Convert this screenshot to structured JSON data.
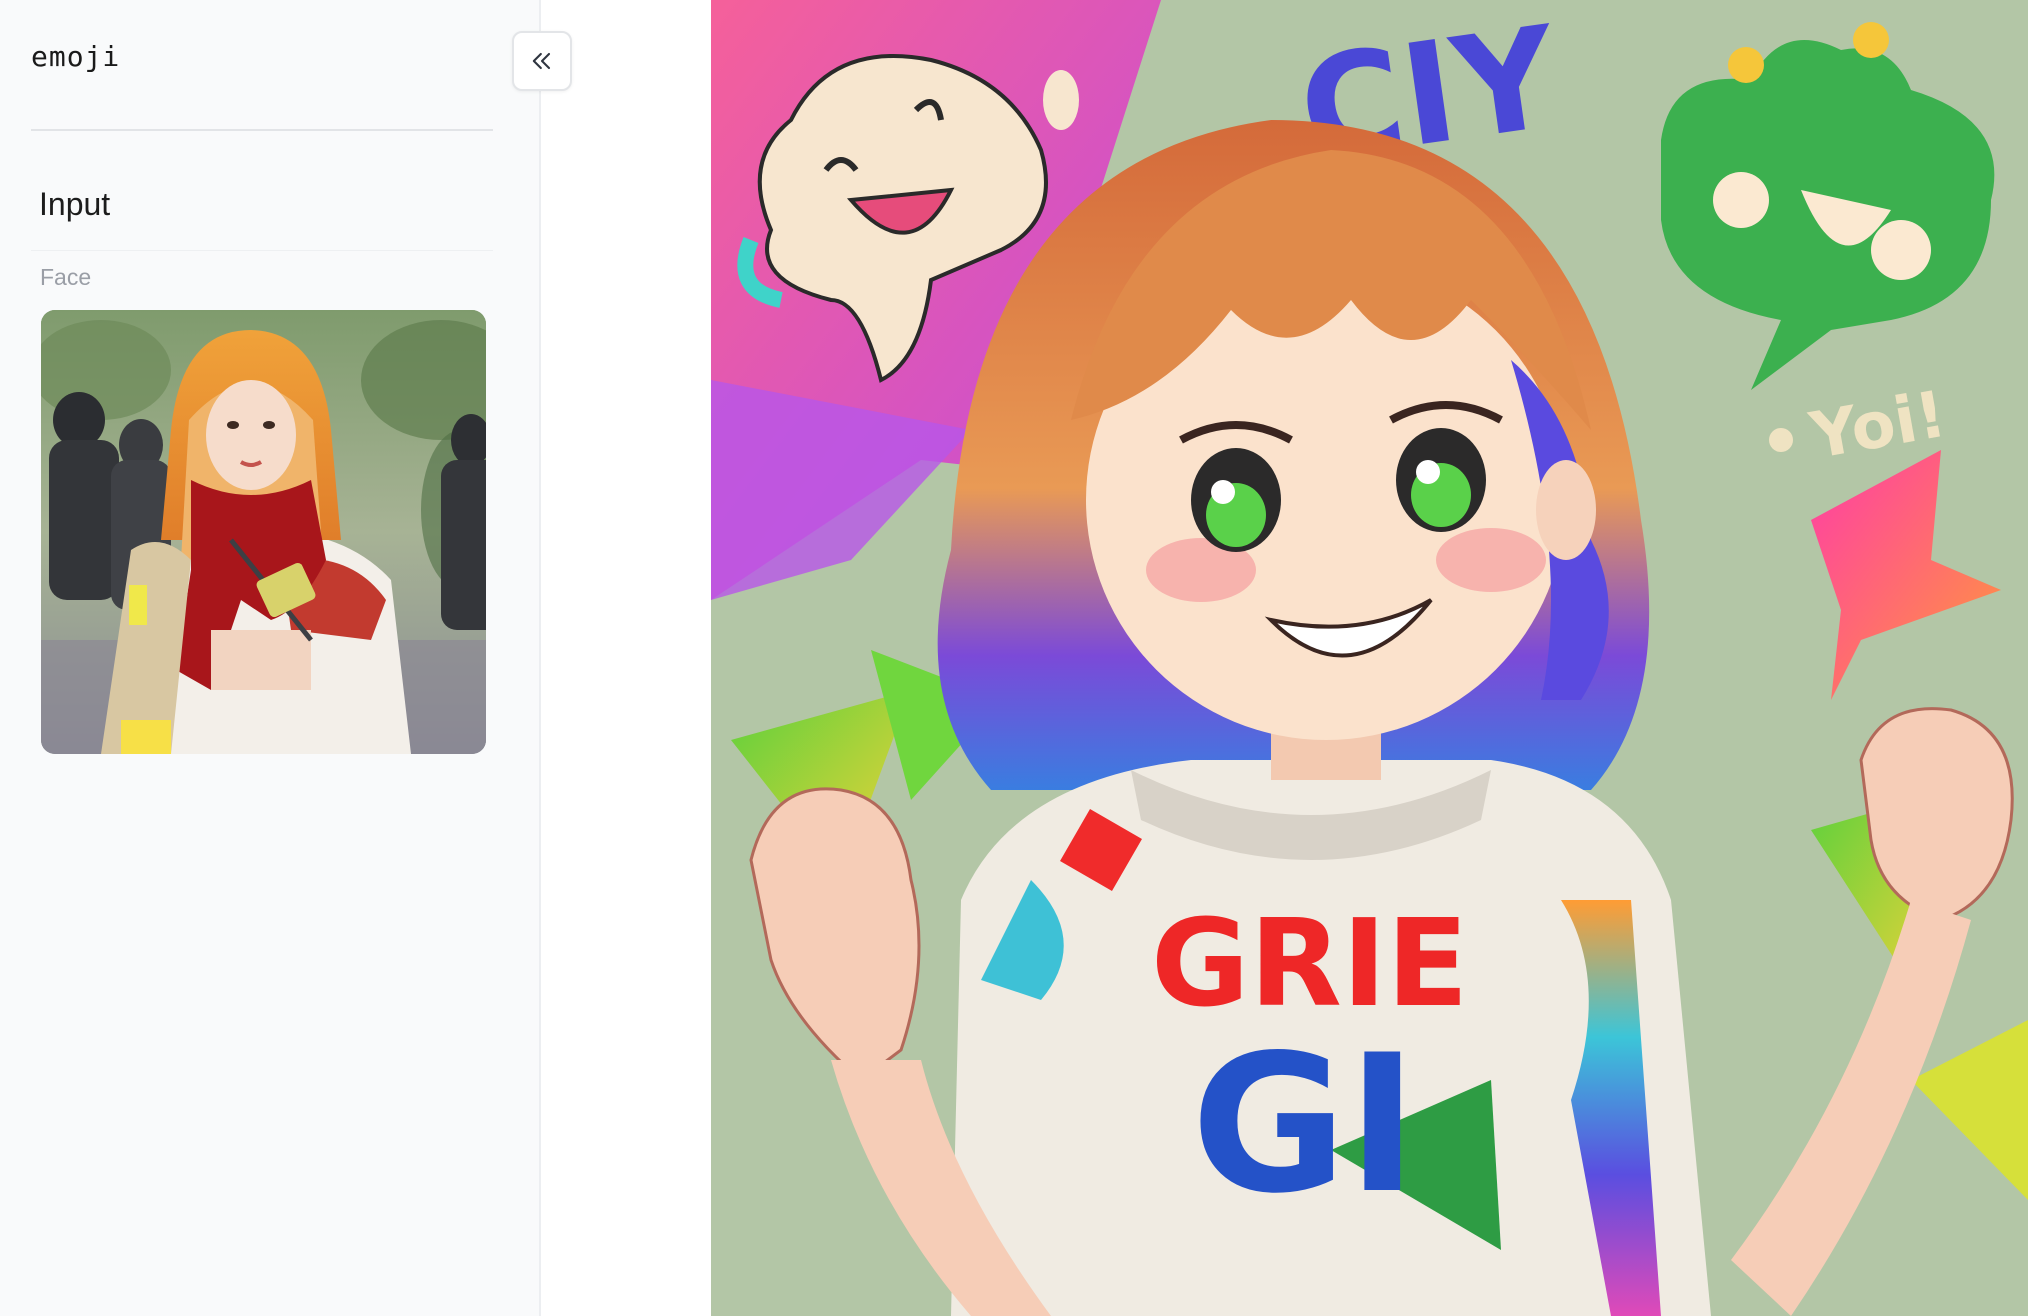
{
  "sidebar": {
    "model_name": "emoji",
    "collapse_icon": "chevrons-left-icon",
    "section_title": "Input",
    "fields": {
      "face_label": "Face"
    }
  },
  "output": {
    "image_text": {
      "top_word": "CIY",
      "bubble_word": "Yoi!",
      "shirt_line1": "GRIE",
      "shirt_line2": "GI"
    }
  },
  "colors": {
    "sidebar_bg": "#f9fafb",
    "divider": "#e2e4e7",
    "label_muted": "#9a9ea6"
  }
}
